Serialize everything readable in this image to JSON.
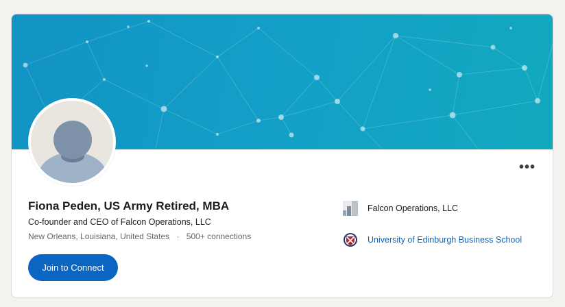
{
  "profile": {
    "name": "Fiona Peden, US Army Retired, MBA",
    "headline": "Co-founder and CEO of Falcon Operations, LLC",
    "location": "New Orleans, Louisiana, United States",
    "separator": "·",
    "connections": "500+ connections",
    "join_label": "Join to Connect",
    "more_label": "•••"
  },
  "affiliations": {
    "company": "Falcon Operations, LLC",
    "school": "University of Edinburgh Business School"
  },
  "icons": {
    "avatar": "default-person-avatar",
    "more": "ellipsis-icon",
    "company_logo": "building-logo",
    "school_logo": "university-crest-logo"
  },
  "colors": {
    "accent": "#0a66c2",
    "banner_start": "#1293c4",
    "banner_end": "#12a9bf"
  }
}
